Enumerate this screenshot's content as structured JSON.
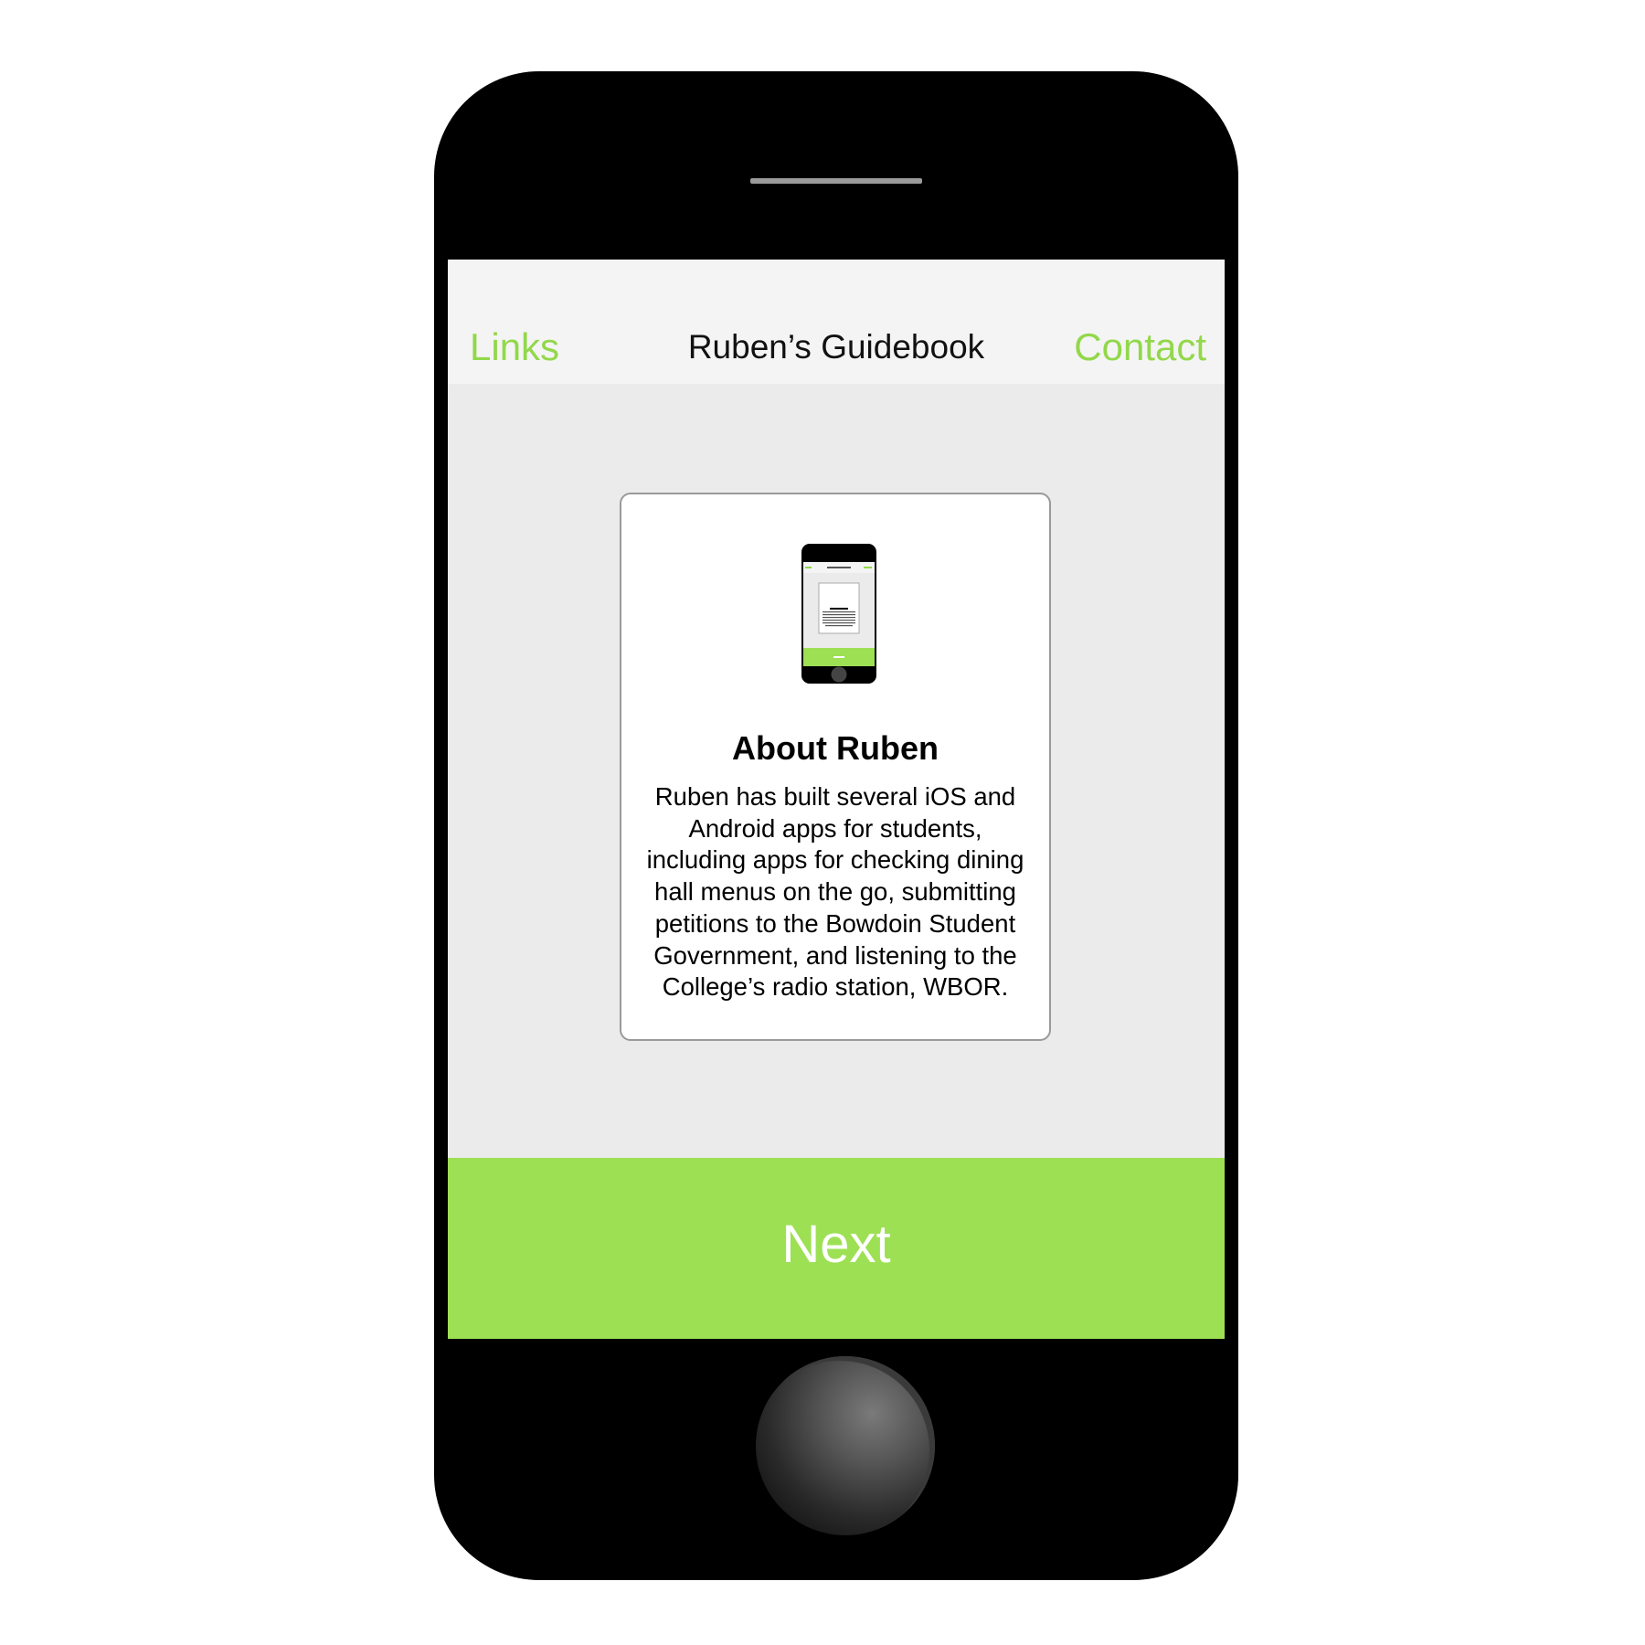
{
  "navbar": {
    "left_link": "Links",
    "title": "Ruben’s Guidebook",
    "right_link": "Contact"
  },
  "card": {
    "title": "About Ruben",
    "body": "Ruben has built several iOS and Android apps for students, including apps for checking dining hall menus on the go, submitting petitions to the Bowdoin Student Government, and listening to the College’s radio station, WBOR.",
    "thumbnail_icon": "phone-mockup-icon"
  },
  "footer": {
    "next_label": "Next"
  },
  "colors": {
    "accent_green": "#9de054",
    "link_green": "#92d84a",
    "phone_body": "#000000",
    "screen_background": "#ebebeb",
    "navbar_background": "#f4f4f4"
  }
}
